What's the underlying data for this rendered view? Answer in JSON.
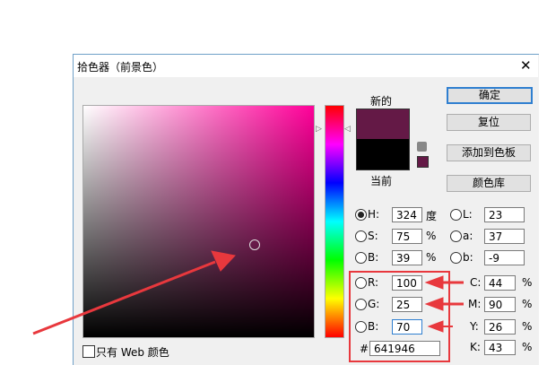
{
  "dialog": {
    "title": "拾色器（前景色）",
    "close": "✕"
  },
  "swatches": {
    "new_label": "新的",
    "current_label": "当前",
    "new_color": "#641946",
    "current_color": "#000000"
  },
  "buttons": {
    "ok": "确定",
    "reset": "复位",
    "add_to_swatches": "添加到色板",
    "color_libraries": "颜色库"
  },
  "fields": {
    "H": {
      "label": "H:",
      "value": "324",
      "unit": "度"
    },
    "S": {
      "label": "S:",
      "value": "75",
      "unit": "%"
    },
    "Bv": {
      "label": "B:",
      "value": "39",
      "unit": "%"
    },
    "R": {
      "label": "R:",
      "value": "100"
    },
    "G": {
      "label": "G:",
      "value": "25"
    },
    "Bb": {
      "label": "B:",
      "value": "70"
    },
    "L": {
      "label": "L:",
      "value": "23"
    },
    "a": {
      "label": "a:",
      "value": "37"
    },
    "b": {
      "label": "b:",
      "value": "-9"
    },
    "C": {
      "label": "C:",
      "value": "44",
      "unit": "%"
    },
    "M": {
      "label": "M:",
      "value": "90",
      "unit": "%"
    },
    "Y": {
      "label": "Y:",
      "value": "26",
      "unit": "%"
    },
    "K": {
      "label": "K:",
      "value": "43",
      "unit": "%"
    },
    "hex": {
      "label": "#",
      "value": "641946"
    }
  },
  "web_only": {
    "label": "只有 Web 颜色",
    "checked": false
  }
}
